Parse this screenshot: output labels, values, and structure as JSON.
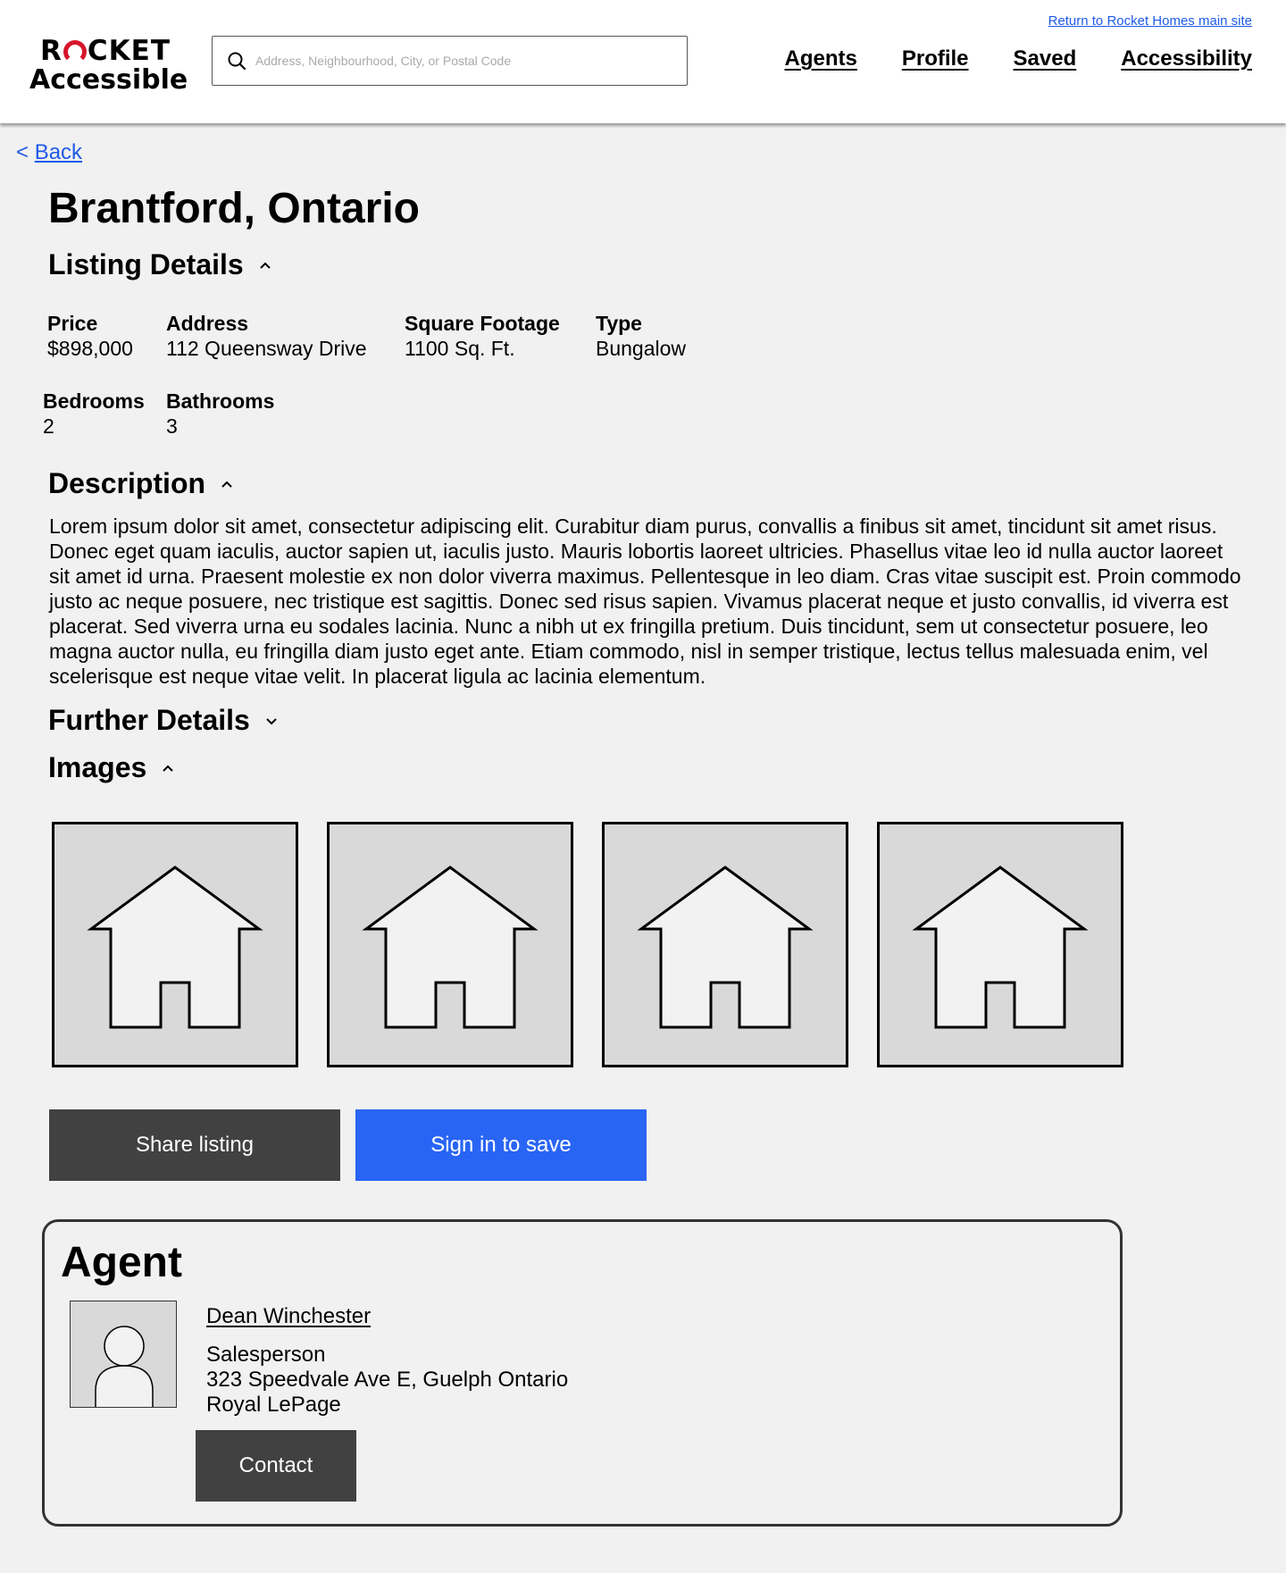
{
  "header": {
    "logo_top": "ROCKET",
    "logo_bottom": "Accessible",
    "search_placeholder": "Address, Neighbourhood, City, or Postal Code",
    "return_link": "Return to Rocket Homes main site",
    "nav": [
      "Agents",
      "Profile",
      "Saved",
      "Accessibility"
    ]
  },
  "back_label": "Back",
  "back_glyph": "<",
  "page_title": "Brantford, Ontario",
  "listing": {
    "heading": "Listing Details",
    "price_label": "Price",
    "price": "$898,000",
    "address_label": "Address",
    "address": "112 Queensway Drive",
    "sqft_label": "Square Footage",
    "sqft": "1100 Sq. Ft.",
    "type_label": "Type",
    "type": "Bungalow",
    "bedrooms_label": "Bedrooms",
    "bedrooms": "2",
    "bathrooms_label": "Bathrooms",
    "bathrooms": "3"
  },
  "description": {
    "heading": "Description",
    "text": "Lorem ipsum dolor sit amet, consectetur adipiscing elit. Curabitur diam purus, convallis a finibus sit amet, tincidunt sit amet risus. Donec eget quam iaculis, auctor sapien ut, iaculis justo. Mauris lobortis laoreet ultricies. Phasellus vitae leo id nulla auctor laoreet sit amet id urna. Praesent molestie ex non dolor viverra maximus. Pellentesque in leo diam. Cras vitae suscipit est. Proin commodo justo ac neque posuere, nec tristique est sagittis. Donec sed risus sapien. Vivamus placerat neque et justo convallis, id viverra est placerat. Sed viverra urna eu sodales lacinia. Nunc a nibh ut ex fringilla pretium. Duis tincidunt, sem ut consectetur posuere, leo magna auctor nulla, eu fringilla diam justo eget ante. Etiam commodo, nisl in semper tristique, lectus tellus malesuada enim, vel scelerisque est neque vitae velit. In placerat ligula ac lacinia elementum."
  },
  "further_details": {
    "heading": "Further Details"
  },
  "images": {
    "heading": "Images",
    "icons": [
      "home-icon",
      "home-icon",
      "home-icon",
      "home-icon"
    ]
  },
  "actions": {
    "share": "Share listing",
    "save": "Sign in to save"
  },
  "agent": {
    "heading": "Agent",
    "name": "Dean Winchester",
    "role": "Salesperson",
    "address": "323 Speedvale Ave E, Guelph Ontario",
    "brokerage": "Royal LePage",
    "contact": "Contact"
  },
  "colors": {
    "accent": "#2965f5",
    "link": "#1f5ae8",
    "dark_button": "#414141",
    "logo_red": "#d6152b"
  }
}
